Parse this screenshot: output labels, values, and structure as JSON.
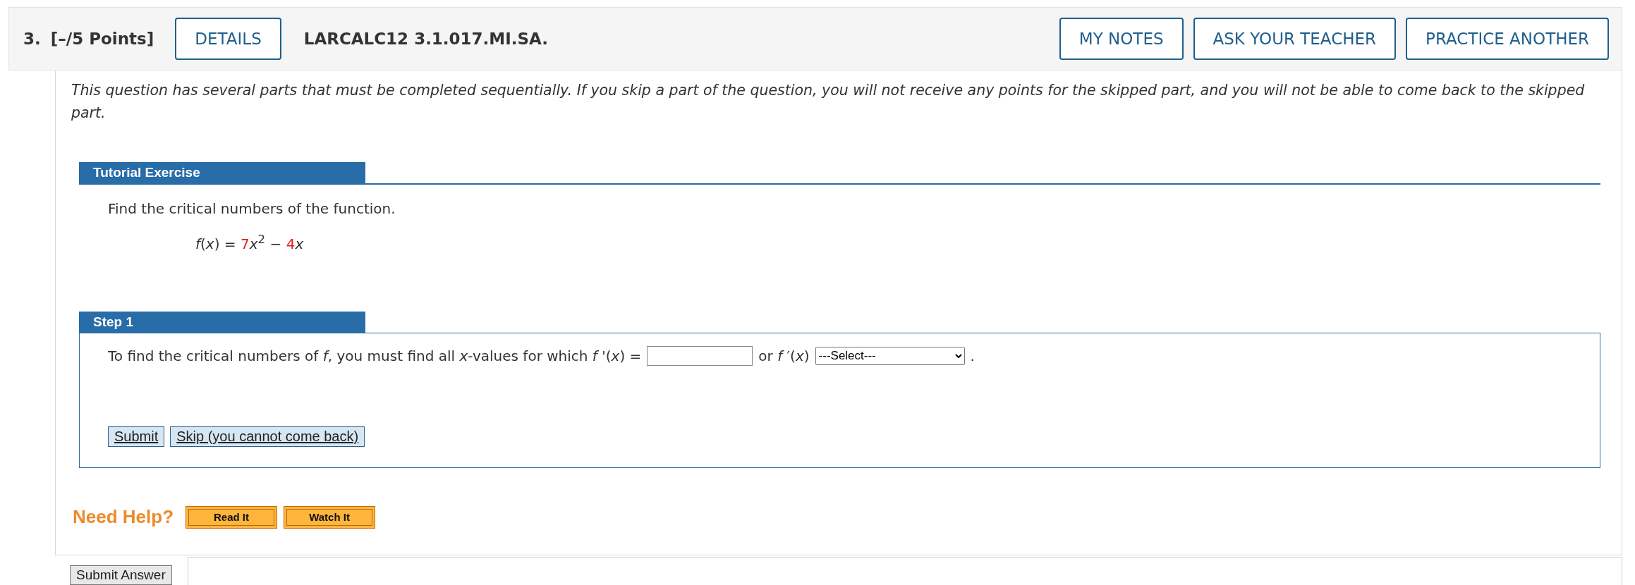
{
  "question": {
    "number": "3.",
    "points": "[–/5 Points]",
    "details_button": "DETAILS",
    "code": "LARCALC12 3.1.017.MI.SA.",
    "buttons": [
      "MY NOTES",
      "ASK YOUR TEACHER",
      "PRACTICE ANOTHER"
    ]
  },
  "intro": "This question has several parts that must be completed sequentially. If you skip a part of the question, you will not receive any points for the skipped part, and you will not be able to come back to the skipped part.",
  "tutorial": {
    "heading": "Tutorial Exercise",
    "prompt": "Find the critical numbers of the function.",
    "formula": [
      {
        "text": "*f*(*x*) = "
      },
      {
        "text": "7",
        "color": "#e0201c"
      },
      {
        "text": "*x*$^{2}$ − "
      },
      {
        "text": "4",
        "color": "#e0201c"
      },
      {
        "text": "*x*"
      }
    ]
  },
  "step": {
    "heading": "Step 1",
    "sentence": "To find the critical numbers of *f*, you must find all *x*-values for which *f* '(*x*) =",
    "between": "or *f* ′(*x*)",
    "select": "---Select---",
    "end": ".",
    "buttons": [
      "Submit",
      "Skip (you cannot come back)"
    ]
  },
  "help": {
    "label": "Need Help?",
    "buttons": [
      "Read It",
      "Watch It"
    ]
  },
  "submit_answer": "Submit Answer"
}
